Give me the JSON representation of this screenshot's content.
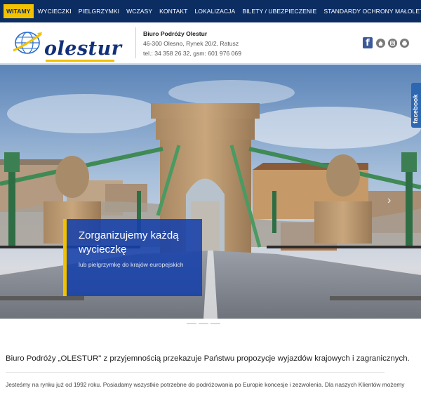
{
  "nav": {
    "items": [
      {
        "label": "WITAMY",
        "active": true
      },
      {
        "label": "WYCIECZKI"
      },
      {
        "label": "PIELGRZYMKI"
      },
      {
        "label": "WCZASY"
      },
      {
        "label": "KONTAKT"
      },
      {
        "label": "LOKALIZACJA"
      },
      {
        "label": "BILETY / UBEZPIECZENIE"
      },
      {
        "label": "STANDARDY OCHRONY MAŁOLETNICH"
      }
    ]
  },
  "header": {
    "logo_text": "olestur",
    "company_name": "Biuro Podróży Olestur",
    "address": "46-300 Olesno, Rynek 20/2, Ratusz",
    "phone": "tel.: 34 358 26 32, gsm: 601 976 069",
    "icons": [
      "facebook-icon",
      "home-icon",
      "instagram-icon",
      "print-icon"
    ]
  },
  "hero": {
    "caption_title": "Zorganizujemy każdą wycieczkę",
    "caption_subtitle": "lub pielgrzymkę do krajów europejskich",
    "facebook_tab": "facebook",
    "slide_count": 3
  },
  "content": {
    "intro": "Biuro Podróży „OLESTUR\" z przyjemnością przekazuje Państwu propozycje wyjazdów krajowych i zagranicznych.",
    "body": "Jesteśmy na rynku już od 1992 roku. Posiadamy wszystkie potrzebne do podróżowania po Europie koncesje i zezwolenia. Dla naszych Klientów możemy"
  },
  "colors": {
    "nav_bg": "#0b2d62",
    "accent": "#f2c100",
    "caption_bg": "#1640aa",
    "facebook": "#3b5998"
  }
}
